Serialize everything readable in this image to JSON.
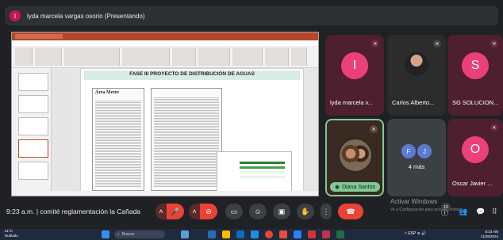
{
  "presenter_bar": {
    "avatar_letter": "I",
    "title": "lyda marcela vargas osorio (Presentando)"
  },
  "slide": {
    "title": "FASE III PROYECTO DE DISTRIBUCIÓN DE AGUAS",
    "doc_head": "Área Metro"
  },
  "participants": [
    {
      "name": "lyda marcela v...",
      "letter": "I",
      "color": "#ec407a"
    },
    {
      "name": "Carlos Alberto...",
      "letter": "",
      "color": "#2c2c2c"
    },
    {
      "name": "SG SOLUCION...",
      "letter": "S",
      "color": "#ec407a"
    },
    {
      "name": "Diana Santos",
      "letter": "",
      "color": "#81c995"
    },
    {
      "name": "4 más",
      "letter": "F J",
      "color": "#5b7bd5"
    },
    {
      "name": "Oscar Javier ...",
      "letter": "O",
      "color": "#ec407a"
    }
  ],
  "meeting": {
    "time": "9:23 a.m.",
    "separator": "|",
    "name": "comité reglamentación la Cañada"
  },
  "windows": {
    "activate_title": "Activar Windows",
    "activate_sub": "Ve a Configuración para activar Windows."
  },
  "taskbar": {
    "weather_temp": "21°C",
    "weather_desc": "Nublado",
    "search": "Buscar",
    "lang": "ESP",
    "time": "8:23 AM",
    "date": "11/28/2024"
  },
  "participant_count": "10"
}
